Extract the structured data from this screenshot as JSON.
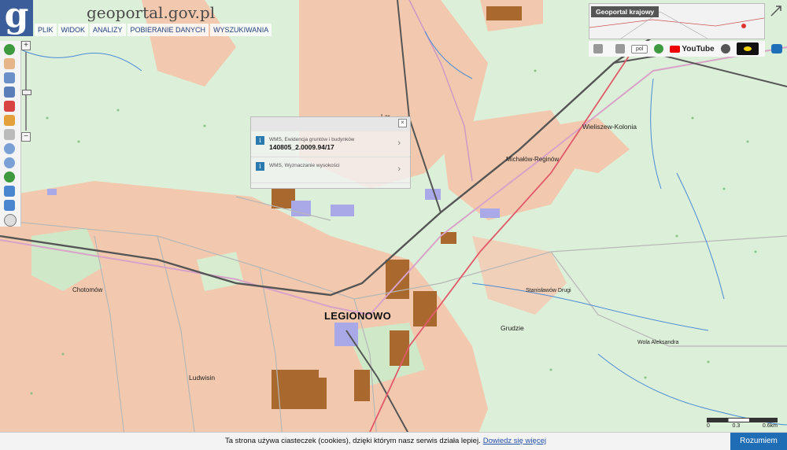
{
  "app": {
    "brand": "geoportal.gov.pl",
    "logo_letter": "g"
  },
  "menu": [
    "PLIK",
    "WIDOK",
    "ANALIZY",
    "POBIERANIE DANYCH",
    "WYSZUKIWANIA"
  ],
  "overview": {
    "label": "Geoportal krajowy"
  },
  "toolbar": {
    "language": "pol",
    "youtube": "YouTube"
  },
  "popup": {
    "items": [
      {
        "layer": "WMS, Ewidencja gruntów i budynków",
        "value": "140805_2.0009.94/17"
      },
      {
        "layer": "WMS, Wyznaczanie wysokości",
        "value": ""
      }
    ]
  },
  "places": {
    "legionowo": "LEGIONOWO",
    "wieliszew": "Wieliszew-Kolonia",
    "michalow": "Michałów-Reginów",
    "chotomow": "Chotomów",
    "stanislawow": "Stanisławów Drugi",
    "grudzie": "Grudzie",
    "wola": "Wola Aleksandra",
    "ludwisin": "Ludwisin",
    "lar": "Lar"
  },
  "scale": {
    "labels": [
      "0",
      "0.3",
      "0.6km"
    ]
  },
  "cookie": {
    "text": "Ta strona używa ciasteczek (cookies), dzięki którym nasz serwis działa lepiej.",
    "link": "Dowiedz się więcej",
    "button": "Rozumiem"
  },
  "colors": {
    "forest": "#dcefd8",
    "urban": "#f2c9ae",
    "rail": "#555555",
    "accent": "#3b5e9b"
  }
}
